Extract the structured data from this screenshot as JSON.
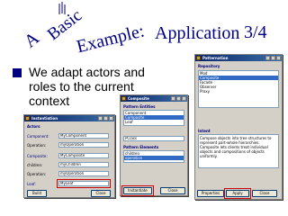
{
  "slide": {
    "title_word1": "A",
    "title_word2": "Basic",
    "title_word3": "Example:",
    "title_word4": "Application",
    "page_number": "3/4",
    "bullet": "We adapt actors and roles to the current context",
    "accent_color": "#000080"
  },
  "patterns_window": {
    "title": "Patternation",
    "section": "Repository",
    "items": [
      "Mod",
      "Composite",
      "Facade",
      "Observer",
      "Proxy"
    ],
    "selected_index": 1,
    "intent_label": "Intent",
    "intent_text": "Compose objects into tree structures to represent part-whole hierarchies. Composite lets clients treat individual objects and compositions of objects uniformly.",
    "buttons": [
      "Properties",
      "Apply",
      "Close"
    ]
  },
  "composite_window": {
    "title": "Composite",
    "entities_label": "Pattern Entities",
    "entities": [
      "Component",
      "Composite",
      "Leaf"
    ],
    "selected_entity": 1,
    "class_field": "PClass",
    "elements_label": "Pattern Elements",
    "elements": [
      "children",
      "operation"
    ],
    "selected_element": 1,
    "buttons": [
      "Instantiate",
      "Close"
    ]
  },
  "instantiation_window": {
    "title": "Instantiation",
    "section": "Actors",
    "rows": [
      {
        "label": "Component:",
        "value": "MyComponent"
      },
      {
        "label": "Operation:",
        "value": "myOperation"
      },
      {
        "label": "Composite:",
        "value": "MyComposite"
      },
      {
        "label": "children:",
        "value": "myChildren"
      },
      {
        "label": "Operation:",
        "value": "myOperation"
      },
      {
        "label": "Leaf:",
        "value": "MyLeaf"
      }
    ],
    "buttons": [
      "Build",
      "Close"
    ]
  }
}
